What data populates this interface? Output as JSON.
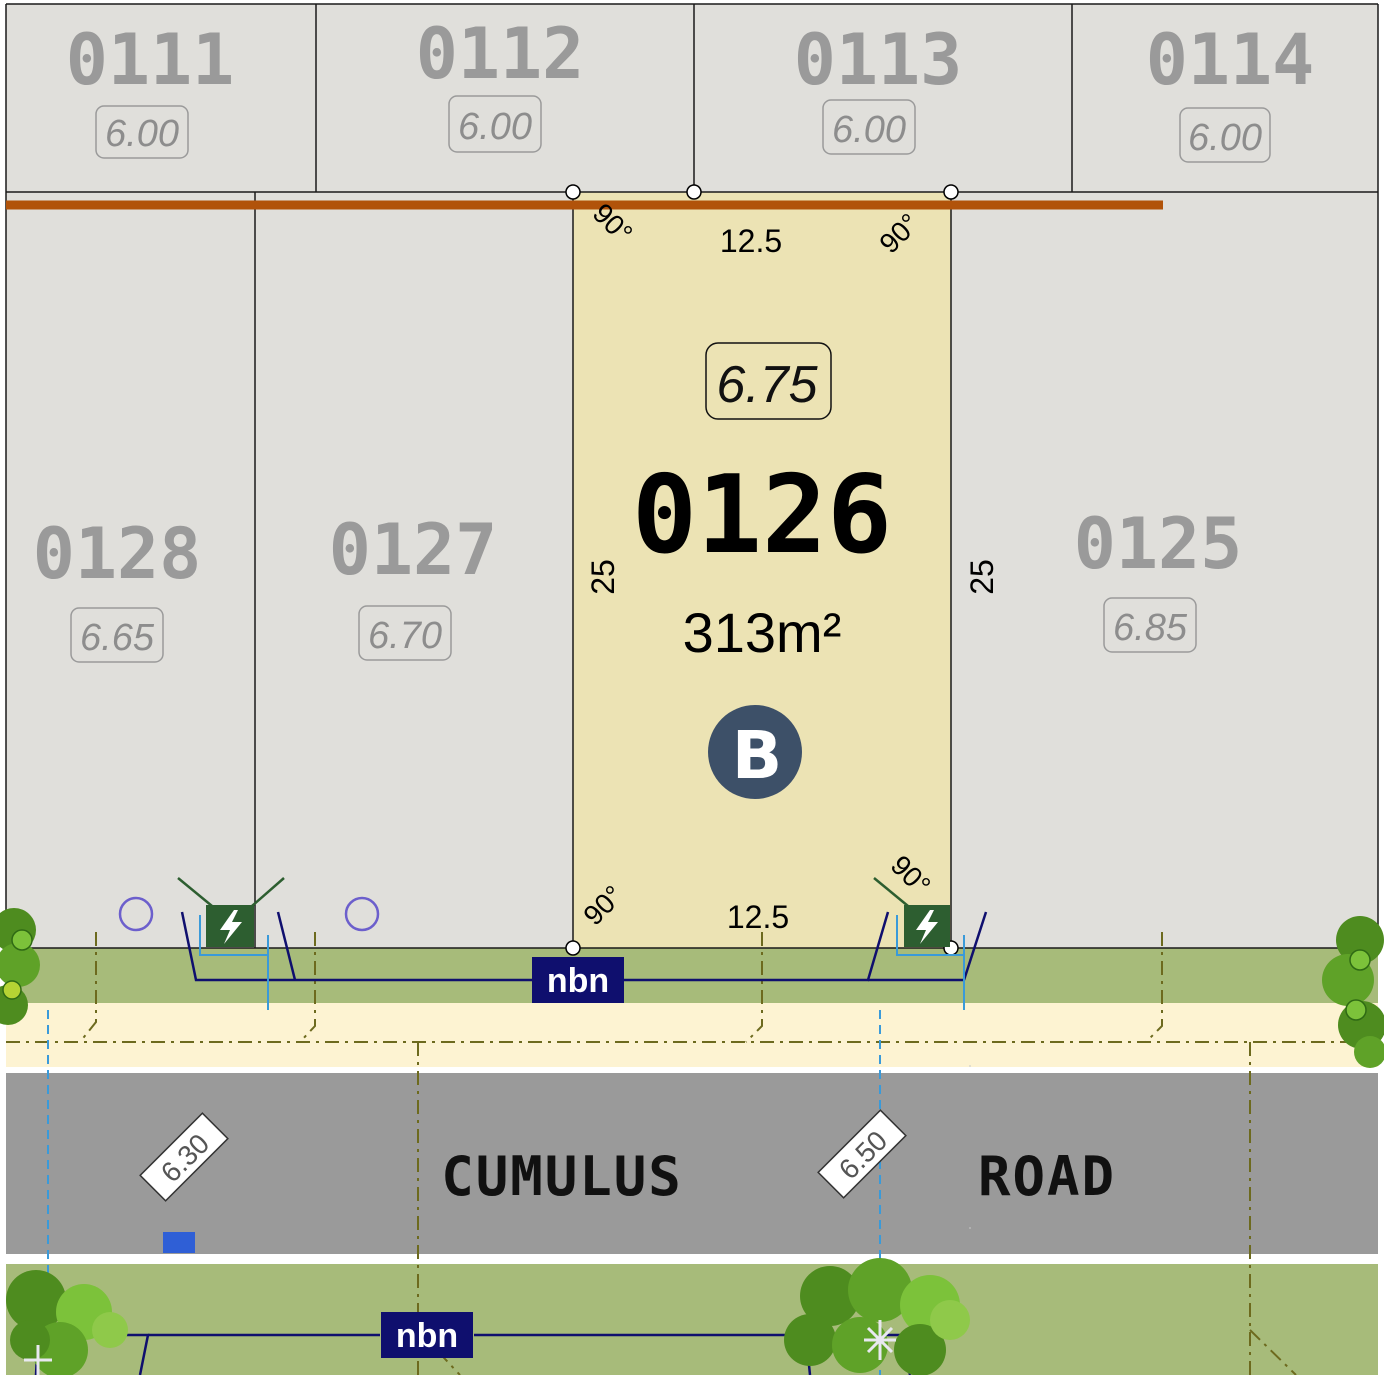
{
  "lots_top": [
    {
      "number": "0111",
      "level": "6.00"
    },
    {
      "number": "0112",
      "level": "6.00"
    },
    {
      "number": "0113",
      "level": "6.00"
    },
    {
      "number": "0114",
      "level": "6.00"
    }
  ],
  "lots_mid": [
    {
      "number": "0128",
      "level": "6.65"
    },
    {
      "number": "0127",
      "level": "6.70"
    },
    {
      "number": "0125",
      "level": "6.85"
    }
  ],
  "selected_lot": {
    "number": "0126",
    "level": "6.75",
    "area": "313m²",
    "badge": "B",
    "frontage_top": "12.5",
    "frontage_bottom": "12.5",
    "depth_left": "25",
    "depth_right": "25",
    "angle": "90°",
    "fill_color": "#ece3b4",
    "badge_color": "#3d5068"
  },
  "road": {
    "name_part1": "CUMULUS",
    "name_part2": "ROAD",
    "levels": [
      "6.30",
      "6.50"
    ]
  },
  "utilities": {
    "nbn_label": "nbn",
    "nbn_color": "#0f0f6e",
    "electric_color": "#2d5e30"
  },
  "colors": {
    "lot_grey": "#e0dfdb",
    "verge_green": "#a7bb7a",
    "footpath": "#fdf3d2",
    "road_grey": "#9a9a9a",
    "boundary_line": "#b1530a"
  }
}
